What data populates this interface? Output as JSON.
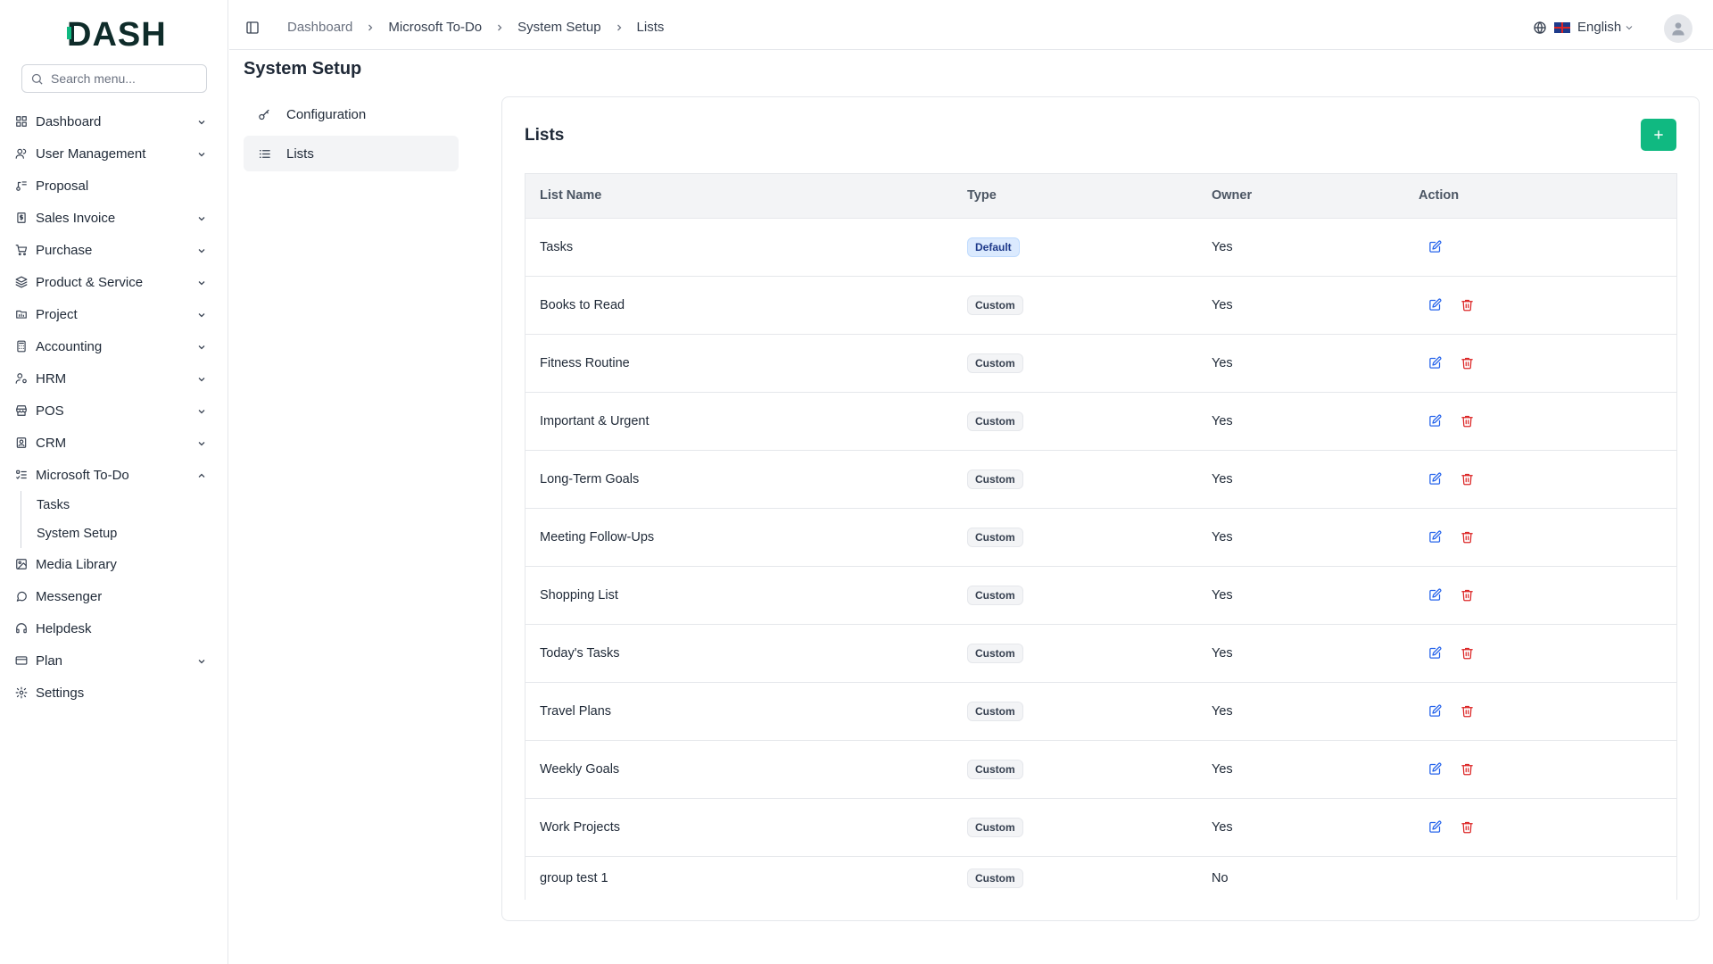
{
  "brand": {
    "logo_text": "DASH"
  },
  "search": {
    "placeholder": "Search menu..."
  },
  "sidebar": {
    "items": [
      {
        "label": "Dashboard",
        "icon": "grid-icon",
        "has_chevron": true
      },
      {
        "label": "User Management",
        "icon": "users-icon",
        "has_chevron": true
      },
      {
        "label": "Proposal",
        "icon": "proposal-icon",
        "has_chevron": false
      },
      {
        "label": "Sales Invoice",
        "icon": "invoice-icon",
        "has_chevron": true
      },
      {
        "label": "Purchase",
        "icon": "cart-icon",
        "has_chevron": true
      },
      {
        "label": "Product & Service",
        "icon": "layers-icon",
        "has_chevron": true
      },
      {
        "label": "Project",
        "icon": "folder-icon",
        "has_chevron": true
      },
      {
        "label": "Accounting",
        "icon": "calculator-icon",
        "has_chevron": true
      },
      {
        "label": "HRM",
        "icon": "user-cog-icon",
        "has_chevron": true
      },
      {
        "label": "POS",
        "icon": "store-icon",
        "has_chevron": true
      },
      {
        "label": "CRM",
        "icon": "contact-icon",
        "has_chevron": true
      },
      {
        "label": "Microsoft To-Do",
        "icon": "list-todo-icon",
        "has_chevron": true,
        "expanded": true
      }
    ],
    "sub_items": [
      {
        "label": "Tasks"
      },
      {
        "label": "System Setup"
      }
    ],
    "items_after": [
      {
        "label": "Media Library",
        "icon": "image-icon",
        "has_chevron": false
      },
      {
        "label": "Messenger",
        "icon": "message-icon",
        "has_chevron": false
      },
      {
        "label": "Helpdesk",
        "icon": "headset-icon",
        "has_chevron": false
      },
      {
        "label": "Plan",
        "icon": "card-icon",
        "has_chevron": true
      },
      {
        "label": "Settings",
        "icon": "gear-icon",
        "has_chevron": false
      }
    ]
  },
  "breadcrumb": [
    "Dashboard",
    "Microsoft To-Do",
    "System Setup",
    "Lists"
  ],
  "language": {
    "label": "English"
  },
  "page": {
    "title": "System Setup"
  },
  "setup_nav": [
    {
      "label": "Configuration",
      "icon": "key-icon",
      "active": false
    },
    {
      "label": "Lists",
      "icon": "list-icon",
      "active": true
    }
  ],
  "card": {
    "title": "Lists",
    "add_button": "+"
  },
  "table": {
    "headers": [
      "List Name",
      "Type",
      "Owner",
      "Action"
    ],
    "rows": [
      {
        "name": "Tasks",
        "type": "Default",
        "owner": "Yes",
        "edit": true,
        "delete": false
      },
      {
        "name": "Books to Read",
        "type": "Custom",
        "owner": "Yes",
        "edit": true,
        "delete": true
      },
      {
        "name": "Fitness Routine",
        "type": "Custom",
        "owner": "Yes",
        "edit": true,
        "delete": true
      },
      {
        "name": "Important & Urgent",
        "type": "Custom",
        "owner": "Yes",
        "edit": true,
        "delete": true
      },
      {
        "name": "Long-Term Goals",
        "type": "Custom",
        "owner": "Yes",
        "edit": true,
        "delete": true
      },
      {
        "name": "Meeting Follow-Ups",
        "type": "Custom",
        "owner": "Yes",
        "edit": true,
        "delete": true
      },
      {
        "name": "Shopping List",
        "type": "Custom",
        "owner": "Yes",
        "edit": true,
        "delete": true
      },
      {
        "name": "Today's Tasks",
        "type": "Custom",
        "owner": "Yes",
        "edit": true,
        "delete": true
      },
      {
        "name": "Travel Plans",
        "type": "Custom",
        "owner": "Yes",
        "edit": true,
        "delete": true
      },
      {
        "name": "Weekly Goals",
        "type": "Custom",
        "owner": "Yes",
        "edit": true,
        "delete": true
      },
      {
        "name": "Work Projects",
        "type": "Custom",
        "owner": "Yes",
        "edit": true,
        "delete": true
      },
      {
        "name": "group test 1",
        "type": "Custom",
        "owner": "No",
        "edit": false,
        "delete": false
      }
    ]
  },
  "colors": {
    "accent": "#10b981",
    "edit": "#2563eb",
    "delete": "#dc2626",
    "default_badge": "#dbeafe"
  }
}
